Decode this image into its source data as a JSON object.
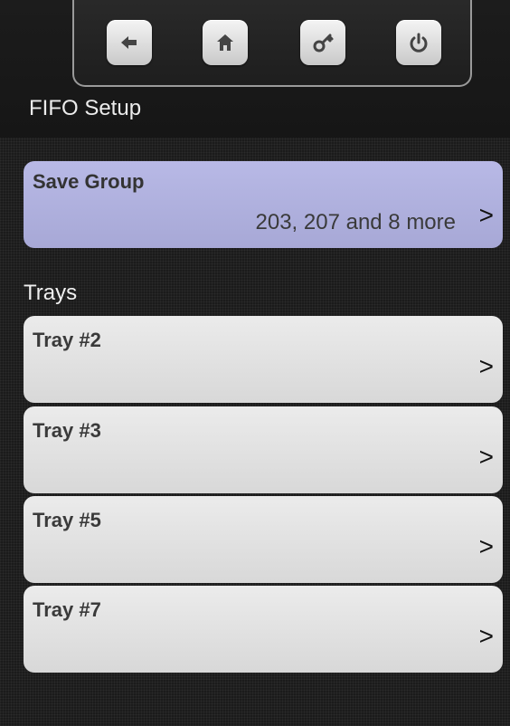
{
  "header": {
    "title": "FIFO Setup",
    "nav_buttons": [
      {
        "name": "back",
        "icon": "back-arrow-icon"
      },
      {
        "name": "home",
        "icon": "home-icon"
      },
      {
        "name": "key",
        "icon": "key-icon"
      },
      {
        "name": "power",
        "icon": "power-icon"
      }
    ]
  },
  "save_group": {
    "label": "Save Group",
    "value": "203, 207 and 8 more",
    "chevron": ">"
  },
  "trays_section": {
    "label": "Trays",
    "items": [
      {
        "label": "Tray #2",
        "chevron": ">"
      },
      {
        "label": "Tray #3",
        "chevron": ">"
      },
      {
        "label": "Tray #5",
        "chevron": ">"
      },
      {
        "label": "Tray #7",
        "chevron": ">"
      }
    ]
  },
  "colors": {
    "background": "#1b1b1b",
    "save_group_bg": "#b0b1de",
    "tray_bg": "#e2e2e2",
    "nav_icon": "#444444"
  }
}
